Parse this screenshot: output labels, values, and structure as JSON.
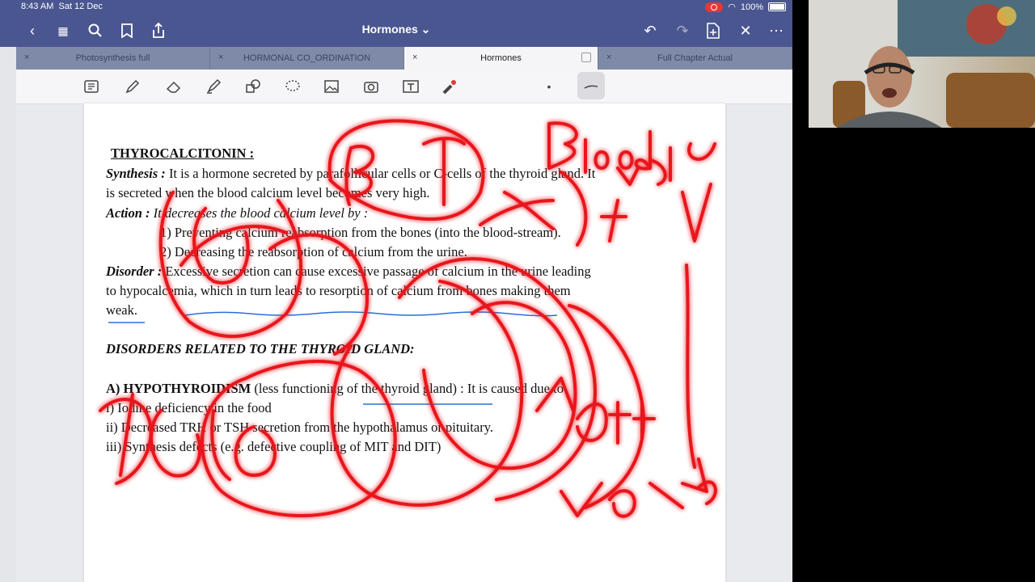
{
  "status": {
    "time": "8:43 AM",
    "date": "Sat 12 Dec",
    "battery": "100%"
  },
  "nav": {
    "title": "Hormones ⌄"
  },
  "tabs": [
    {
      "label": "Photosynthesis full"
    },
    {
      "label": "HORMONAL CO_ORDINATION"
    },
    {
      "label": "Hormones"
    },
    {
      "label": "Full Chapter Actual"
    }
  ],
  "doc": {
    "heading": "THYROCALCITONIN :",
    "synthesis_label": "Synthesis :",
    "synthesis_text": " It is a hormone secreted by parafollicular cells or C-cells of the thyroid gland. It",
    "synthesis_text2": "is secreted when the blood calcium level becomes very high.",
    "action_label": "Action :",
    "action_text": " It decreases the blood calcium level by :",
    "action_1": "1) Preventing calcium reabsorption from the bones (into the blood-stream).",
    "action_2": "2) Decreasing the reabsorption of calcium from the urine.",
    "disorder_label": "Disorder :",
    "disorder_text": " Excessive secretion can cause excessive passage of calcium in the urine leading",
    "disorder_text2": "to hypocalcemia, which in turn leads to resorption of calcium from bones making them",
    "disorder_text3": "weak.",
    "disorders_heading": "DISORDERS RELATED TO THE THYROID GLAND:",
    "hypo_label": "A) HYPOTHYROIDISM",
    "hypo_text": " (less functioning of the thyroid gland) : It is caused due to",
    "cause_1": "i) Iodine deficiency in the food",
    "cause_2": "ii) Decreased TRH or TSH secretion from the hypothalamus or pituitary.",
    "cause_3": "iii) Synthesis defects (e.g. defective coupling of MIT and DIT)"
  },
  "colors": {
    "nav": "#4a5690",
    "tabs": "#7f8aa8",
    "ink_red": "#e8141c",
    "ink_blue": "#2a6fd6"
  }
}
